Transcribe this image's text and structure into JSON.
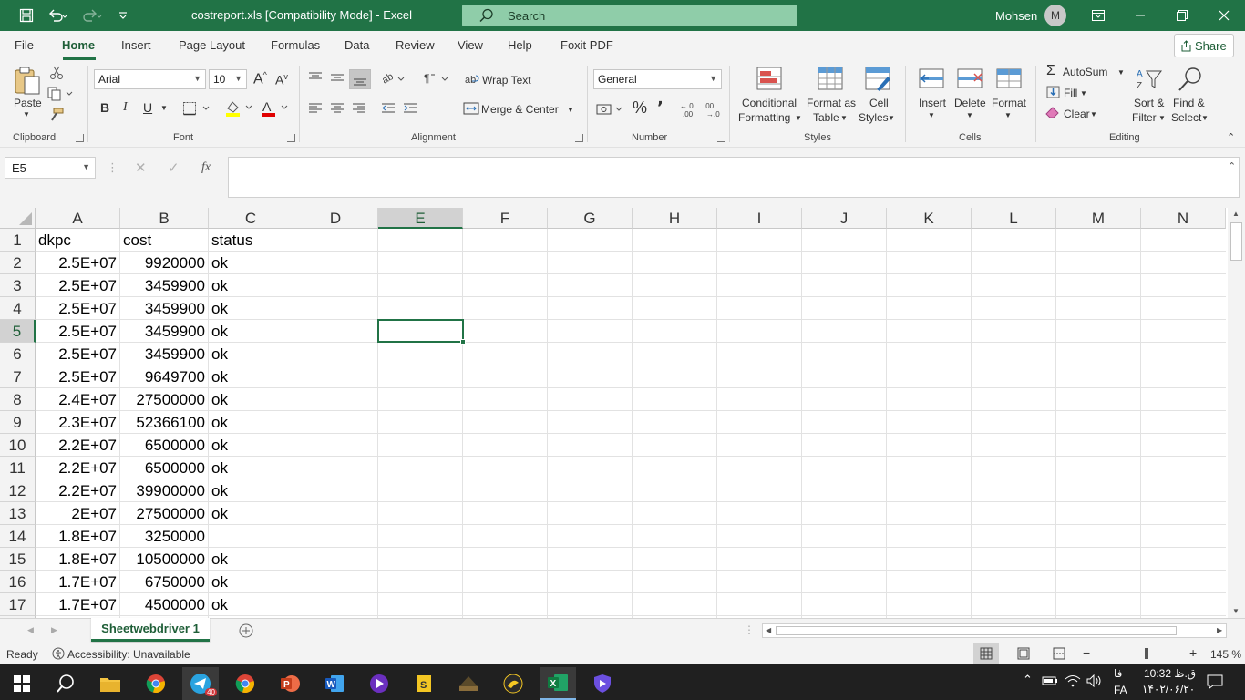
{
  "titlebar": {
    "document_title": "costreport.xls  [Compatibility Mode]  -  Excel",
    "search_placeholder": "Search",
    "user_name": "Mohsen",
    "user_initial": "M",
    "accent_color": "#217346"
  },
  "menu": {
    "tabs": [
      "File",
      "Home",
      "Insert",
      "Page Layout",
      "Formulas",
      "Data",
      "Review",
      "View",
      "Help",
      "Foxit PDF"
    ],
    "active_tab": "Home",
    "share_label": "Share"
  },
  "ribbon": {
    "clipboard": {
      "paste_label": "Paste",
      "group_label": "Clipboard"
    },
    "font": {
      "font_name": "Arial",
      "font_size": "10",
      "bold": "B",
      "italic": "I",
      "underline": "U",
      "group_label": "Font"
    },
    "alignment": {
      "wrap_text": "Wrap Text",
      "merge_center": "Merge & Center",
      "group_label": "Alignment"
    },
    "number": {
      "format": "General",
      "percent": "%",
      "comma": "٬",
      "group_label": "Number"
    },
    "styles": {
      "conditional_line1": "Conditional",
      "conditional_line2": "Formatting",
      "format_table_line1": "Format as",
      "format_table_line2": "Table",
      "cell_styles_line1": "Cell",
      "cell_styles_line2": "Styles",
      "group_label": "Styles"
    },
    "cells": {
      "insert": "Insert",
      "delete": "Delete",
      "format": "Format",
      "group_label": "Cells"
    },
    "editing": {
      "autosum": "AutoSum",
      "fill": "Fill",
      "clear": "Clear",
      "sort_line1": "Sort &",
      "sort_line2": "Filter",
      "find_line1": "Find &",
      "find_line2": "Select",
      "group_label": "Editing"
    }
  },
  "formula_bar": {
    "name_box": "E5",
    "fx": "fx",
    "formula": ""
  },
  "sheet": {
    "columns": [
      "A",
      "B",
      "C",
      "D",
      "E",
      "F",
      "G",
      "H",
      "I",
      "J",
      "K",
      "L",
      "M",
      "N"
    ],
    "selected_column": "E",
    "selected_row": "5",
    "rows": [
      {
        "row": "1",
        "a": "dkpc",
        "b": "cost",
        "c": "status"
      },
      {
        "row": "2",
        "a": "2.5E+07",
        "b": "9920000",
        "c": "ok"
      },
      {
        "row": "3",
        "a": "2.5E+07",
        "b": "3459900",
        "c": "ok"
      },
      {
        "row": "4",
        "a": "2.5E+07",
        "b": "3459900",
        "c": "ok"
      },
      {
        "row": "5",
        "a": "2.5E+07",
        "b": "3459900",
        "c": "ok"
      },
      {
        "row": "6",
        "a": "2.5E+07",
        "b": "3459900",
        "c": "ok"
      },
      {
        "row": "7",
        "a": "2.5E+07",
        "b": "9649700",
        "c": "ok"
      },
      {
        "row": "8",
        "a": "2.4E+07",
        "b": "27500000",
        "c": "ok"
      },
      {
        "row": "9",
        "a": "2.3E+07",
        "b": "52366100",
        "c": "ok"
      },
      {
        "row": "10",
        "a": "2.2E+07",
        "b": "6500000",
        "c": "ok"
      },
      {
        "row": "11",
        "a": "2.2E+07",
        "b": "6500000",
        "c": "ok"
      },
      {
        "row": "12",
        "a": "2.2E+07",
        "b": "39900000",
        "c": "ok"
      },
      {
        "row": "13",
        "a": "2E+07",
        "b": "27500000",
        "c": "ok"
      },
      {
        "row": "14",
        "a": "1.8E+07",
        "b": "3250000",
        "c": ""
      },
      {
        "row": "15",
        "a": "1.8E+07",
        "b": "10500000",
        "c": "ok"
      },
      {
        "row": "16",
        "a": "1.7E+07",
        "b": "6750000",
        "c": "ok"
      },
      {
        "row": "17",
        "a": "1.7E+07",
        "b": "4500000",
        "c": "ok"
      }
    ]
  },
  "sheet_tabs": {
    "active": "Sheetwebdriver 1"
  },
  "status_bar": {
    "ready": "Ready",
    "accessibility": "Accessibility: Unavailable",
    "zoom": "145 %"
  },
  "taskbar": {
    "badge": "40",
    "time": "10:32 ق.ظ",
    "date": "۱۴۰۲/۰۶/۲۰",
    "lang_top": "فا",
    "lang_bottom": "FA"
  }
}
